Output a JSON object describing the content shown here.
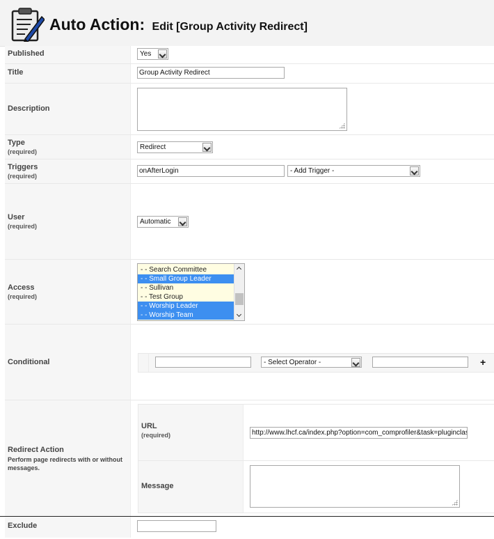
{
  "header": {
    "title": "Auto Action:",
    "subtitle": "Edit [Group Activity Redirect]",
    "logo_icon": "checklist-pencil-icon"
  },
  "fields": {
    "published": {
      "label": "Published",
      "value": "Yes"
    },
    "title": {
      "label": "Title",
      "value": "Group Activity Redirect"
    },
    "description": {
      "label": "Description",
      "value": ""
    },
    "type": {
      "label": "Type",
      "required": "(required)",
      "value": "Redirect"
    },
    "triggers": {
      "label": "Triggers",
      "required": "(required)",
      "value": "onAfterLogin",
      "add_trigger": "- Add Trigger -"
    },
    "user": {
      "label": "User",
      "required": "(required)",
      "value": "Automatic"
    },
    "access": {
      "label": "Access",
      "required": "(required)",
      "options": [
        {
          "text": "- - Search Committee",
          "selected": false
        },
        {
          "text": "- - Small Group Leader",
          "selected": true
        },
        {
          "text": "- - Sullivan",
          "selected": false
        },
        {
          "text": "- - Test Group",
          "selected": false
        },
        {
          "text": "- - Worship Leader",
          "selected": true
        },
        {
          "text": "- - Worship Team",
          "selected": true
        }
      ]
    },
    "conditional": {
      "label": "Conditional",
      "field1": "",
      "operator": "- Select Operator -",
      "field2": "",
      "add_label": "+"
    },
    "redirect_action": {
      "label": "Redirect Action",
      "description": "Perform page redirects with or without messages.",
      "url_label": "URL",
      "url_required": "(required)",
      "url_value": "http://www.lhcf.ca/index.php?option=com_comprofiler&task=pluginclass",
      "message_label": "Message",
      "message_value": ""
    },
    "exclude": {
      "label": "Exclude",
      "value": ""
    }
  }
}
